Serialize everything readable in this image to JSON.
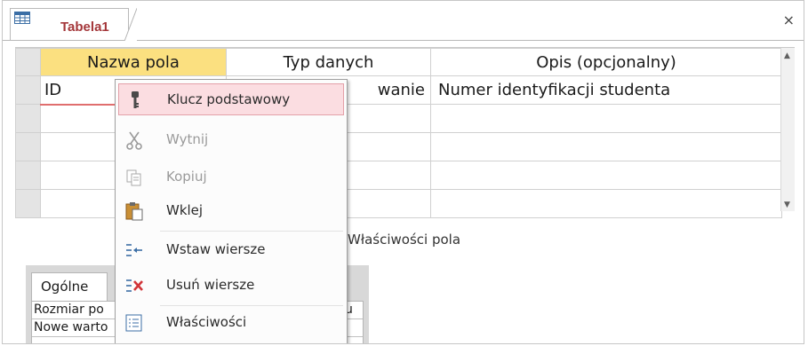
{
  "tab": {
    "title": "Tabela1",
    "close": "×"
  },
  "grid": {
    "headers": {
      "name": "Nazwa pola",
      "type": "Typ danych",
      "desc": "Opis (opcjonalny)"
    },
    "rows": [
      {
        "name": "ID",
        "type": "wanie",
        "desc": "Numer identyfikacji studenta"
      },
      {
        "name": "",
        "type": "",
        "desc": ""
      },
      {
        "name": "",
        "type": "",
        "desc": ""
      },
      {
        "name": "",
        "type": "",
        "desc": ""
      },
      {
        "name": "",
        "type": "",
        "desc": ""
      }
    ]
  },
  "properties_label": "Właściwości pola",
  "properties": {
    "tab": "Ogólne",
    "rows": [
      {
        "key": "Rozmiar po",
        "value": "łu"
      },
      {
        "key": "Nowe warto",
        "value": ""
      }
    ]
  },
  "context_menu": {
    "items": [
      {
        "label": "Klucz podstawowy",
        "icon": "key-icon",
        "disabled": false,
        "highlighted": true
      },
      {
        "label": "Wytnij",
        "icon": "scissors-icon",
        "disabled": true
      },
      {
        "label": "Kopiuj",
        "icon": "copy-icon",
        "disabled": true
      },
      {
        "label": "Wklej",
        "icon": "paste-icon",
        "disabled": false
      },
      {
        "label": "Wstaw wiersze",
        "icon": "insert-rows-icon",
        "disabled": false
      },
      {
        "label": "Usuń wiersze",
        "icon": "delete-rows-icon",
        "disabled": false
      },
      {
        "label": "Właściwości",
        "icon": "properties-icon",
        "disabled": false
      }
    ]
  },
  "colors": {
    "header_accent": "#fbe080",
    "tab_title": "#a4373a",
    "menu_highlight": "#fbdde1"
  }
}
